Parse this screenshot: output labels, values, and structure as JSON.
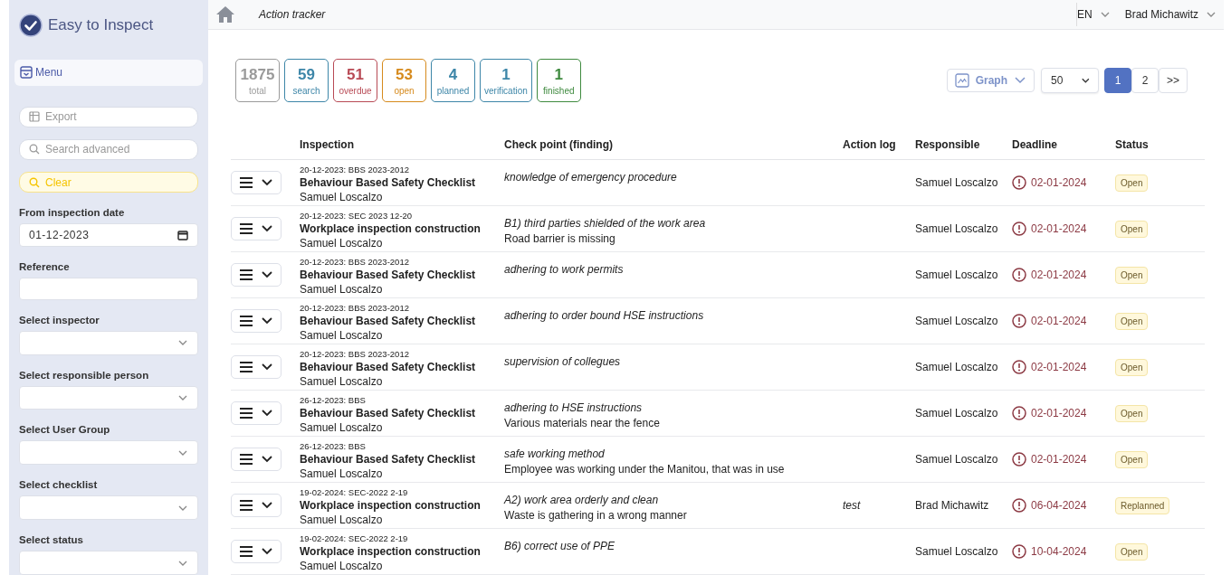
{
  "app": {
    "name": "Easy to Inspect"
  },
  "sidebar": {
    "menu": "Menu",
    "export": "Export",
    "search_advanced": "Search advanced",
    "clear": "Clear",
    "fields": [
      {
        "kind": "date",
        "label": "From inspection date",
        "value": "01-12-2023"
      },
      {
        "kind": "text",
        "label": "Reference"
      },
      {
        "kind": "select",
        "label": "Select inspector"
      },
      {
        "kind": "select",
        "label": "Select responsible person"
      },
      {
        "kind": "select",
        "label": "Select User Group"
      },
      {
        "kind": "select",
        "label": "Select checklist"
      },
      {
        "kind": "select",
        "label": "Select status"
      }
    ]
  },
  "topbar": {
    "title": "Action tracker",
    "language": "EN",
    "user": "Brad Michawitz"
  },
  "counters": [
    {
      "count": "1875",
      "label": "total",
      "color": "#9a9a9a"
    },
    {
      "count": "59",
      "label": "search",
      "color": "#3d86a8"
    },
    {
      "count": "51",
      "label": "overdue",
      "color": "#b84a55"
    },
    {
      "count": "53",
      "label": "open",
      "color": "#d68a1c"
    },
    {
      "count": "4",
      "label": "planned",
      "color": "#3d86a8"
    },
    {
      "count": "1",
      "label": "verification",
      "color": "#3d86a8"
    },
    {
      "count": "1",
      "label": "finished",
      "color": "#3f8a3f"
    }
  ],
  "graph_button": "Graph",
  "page_size": "50",
  "pagination": [
    {
      "label": "1",
      "selected": true
    },
    {
      "label": "2",
      "selected": false
    },
    {
      "label": ">>",
      "selected": false
    }
  ],
  "table": {
    "columns": [
      "Inspection",
      "Check point (finding)",
      "Action log",
      "Responsible",
      "Deadline",
      "Status"
    ],
    "rows": [
      {
        "ref": "20-12-2023: BBS 2023-2012",
        "checklist": "Behaviour Based Safety Checklist",
        "inspector": "Samuel Loscalzo",
        "checkpoint": "knowledge of emergency procedure",
        "responsible": "Samuel Loscalzo",
        "deadline": "02-01-2024",
        "status": "Open"
      },
      {
        "ref": "20-12-2023: SEC 2023 12-20",
        "checklist": "Workplace inspection construction",
        "inspector": "Samuel Loscalzo",
        "checkpoint": "B1) third parties shielded of the work area",
        "finding": "Road barrier is missing",
        "responsible": "Samuel Loscalzo",
        "deadline": "02-01-2024",
        "status": "Open"
      },
      {
        "ref": "20-12-2023: BBS 2023-2012",
        "checklist": "Behaviour Based Safety Checklist",
        "inspector": "Samuel Loscalzo",
        "checkpoint": "adhering to work permits",
        "responsible": "Samuel Loscalzo",
        "deadline": "02-01-2024",
        "status": "Open"
      },
      {
        "ref": "20-12-2023: BBS 2023-2012",
        "checklist": "Behaviour Based Safety Checklist",
        "inspector": "Samuel Loscalzo",
        "checkpoint": "adhering to order bound HSE instructions",
        "responsible": "Samuel Loscalzo",
        "deadline": "02-01-2024",
        "status": "Open"
      },
      {
        "ref": "20-12-2023: BBS 2023-2012",
        "checklist": "Behaviour Based Safety Checklist",
        "inspector": "Samuel Loscalzo",
        "checkpoint": "supervision of collegues",
        "responsible": "Samuel Loscalzo",
        "deadline": "02-01-2024",
        "status": "Open"
      },
      {
        "ref": "26-12-2023: BBS",
        "checklist": "Behaviour Based Safety Checklist",
        "inspector": "Samuel Loscalzo",
        "checkpoint": "adhering to HSE instructions",
        "finding": "Various materials near the fence",
        "responsible": "Samuel Loscalzo",
        "deadline": "02-01-2024",
        "status": "Open"
      },
      {
        "ref": "26-12-2023: BBS",
        "checklist": "Behaviour Based Safety Checklist",
        "inspector": "Samuel Loscalzo",
        "checkpoint": "safe working method",
        "finding": "Employee was working under the Manitou, that was in use",
        "responsible": "Samuel Loscalzo",
        "deadline": "02-01-2024",
        "status": "Open"
      },
      {
        "ref": "19-02-2024: SEC-2022 2-19",
        "checklist": "Workplace inspection construction",
        "inspector": "Samuel Loscalzo",
        "checkpoint": "A2) work area orderly and clean",
        "finding": "Waste is gathering in a wrong manner",
        "action_log": "test",
        "responsible": "Brad Michawitz",
        "deadline": "06-04-2024",
        "status": "Replanned"
      },
      {
        "ref": "19-02-2024: SEC-2022 2-19",
        "checklist": "Workplace inspection construction",
        "inspector": "Samuel Loscalzo",
        "checkpoint": "B6) correct use of PPE",
        "responsible": "Samuel Loscalzo",
        "deadline": "10-04-2024",
        "status": "Open"
      }
    ]
  }
}
